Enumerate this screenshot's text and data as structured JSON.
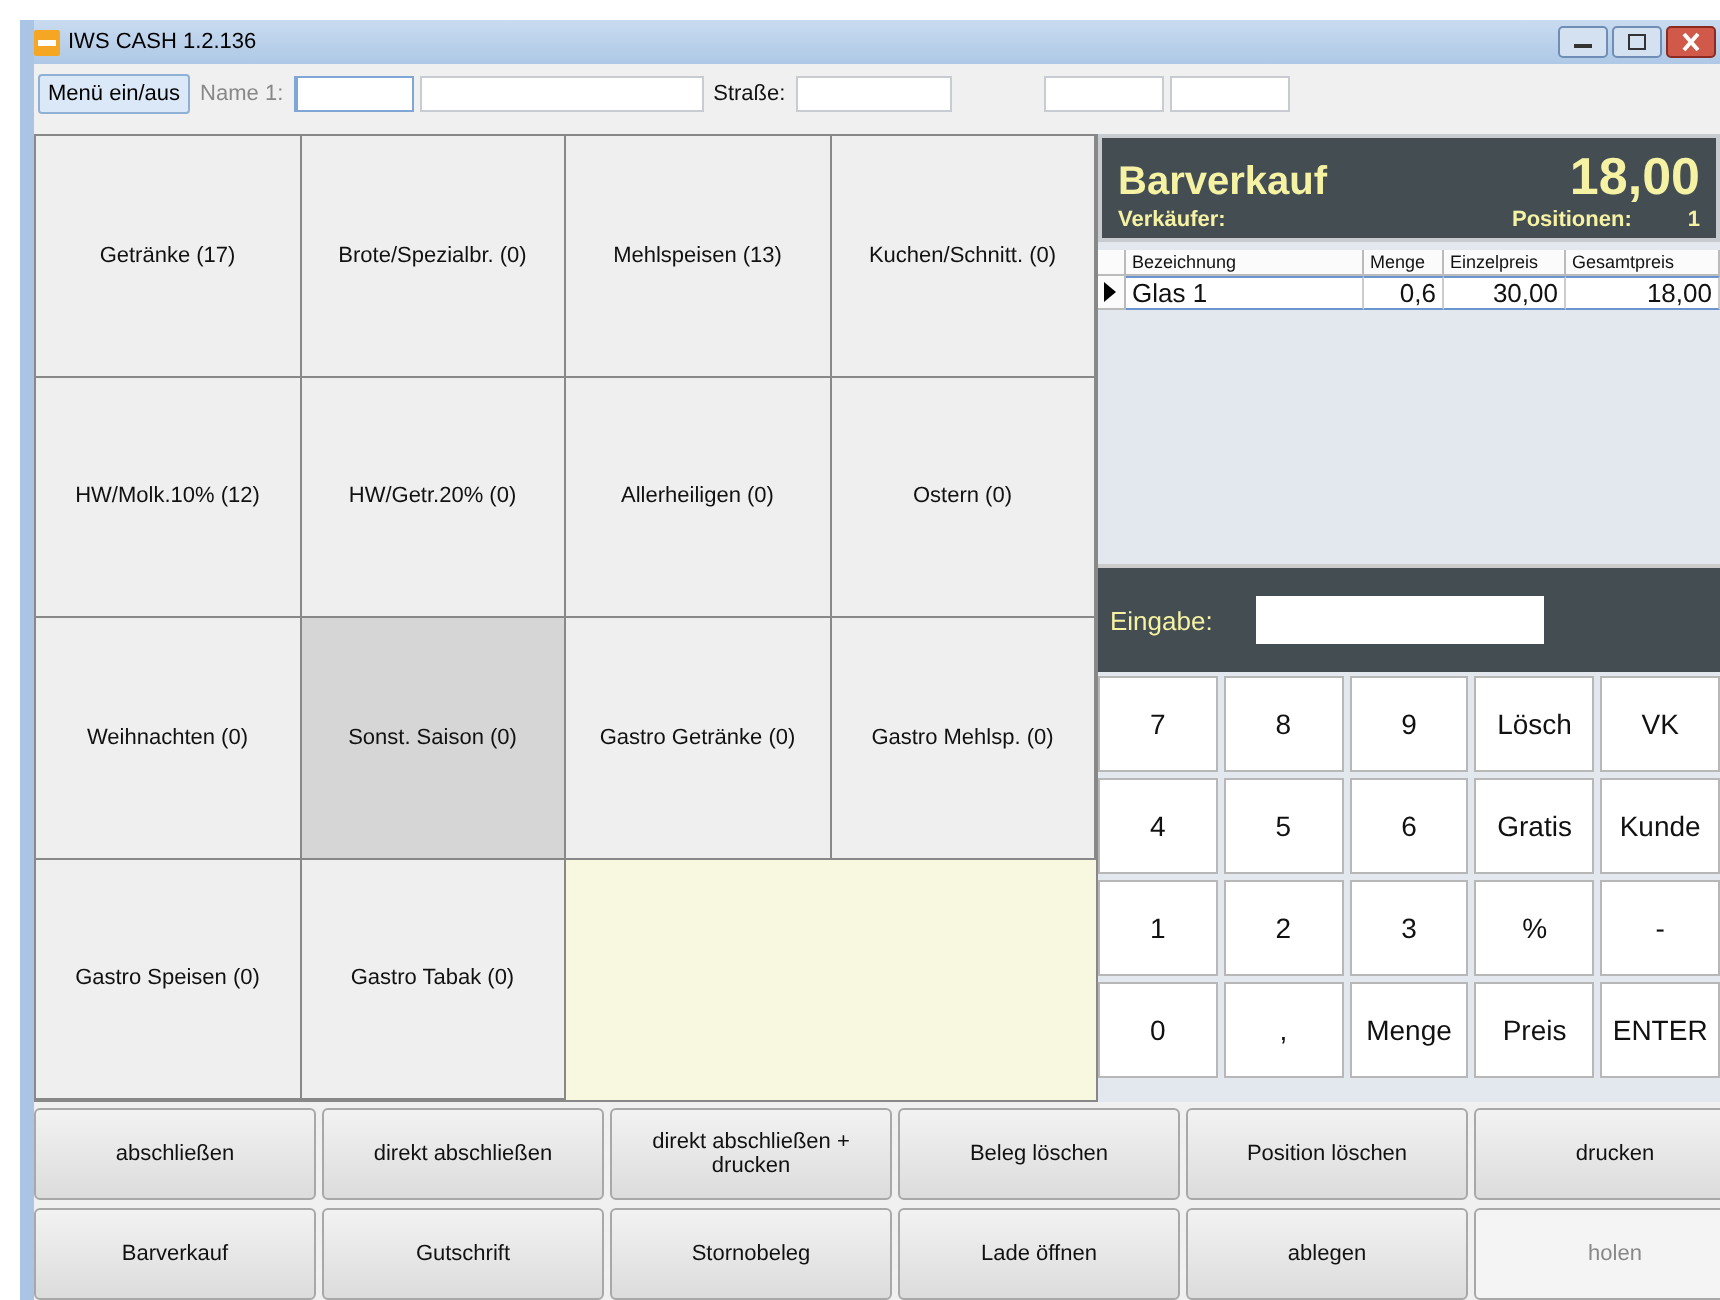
{
  "window": {
    "title": "IWS CASH 1.2.136"
  },
  "toolbar": [
    {
      "kind": "button",
      "label": "Menü ein/aus"
    },
    {
      "kind": "label",
      "label": "Name 1:",
      "dimmed": true
    },
    {
      "kind": "field",
      "focused": true
    },
    {
      "kind": "field",
      "focused": false
    },
    {
      "kind": "label",
      "label": "Straße:",
      "dimmed": false
    },
    {
      "kind": "field",
      "focused": false
    },
    {
      "kind": "gap"
    },
    {
      "kind": "field",
      "focused": false
    },
    {
      "kind": "field",
      "focused": false
    }
  ],
  "categories": [
    {
      "label": "Getränke (17)",
      "selected": false
    },
    {
      "label": "Brote/Spezialbr. (0)",
      "selected": false
    },
    {
      "label": "Mehlspeisen (13)",
      "selected": false
    },
    {
      "label": "Kuchen/Schnitt. (0)",
      "selected": false
    },
    {
      "label": "HW/Molk.10% (12)",
      "selected": false
    },
    {
      "label": "HW/Getr.20% (0)",
      "selected": false
    },
    {
      "label": "Allerheiligen (0)",
      "selected": false
    },
    {
      "label": "Ostern (0)",
      "selected": false
    },
    {
      "label": "Weihnachten (0)",
      "selected": false
    },
    {
      "label": "Sonst. Saison (0)",
      "selected": true
    },
    {
      "label": "Gastro Getränke (0)",
      "selected": false
    },
    {
      "label": "Gastro Mehlsp. (0)",
      "selected": false
    },
    {
      "label": "Gastro Speisen (0)",
      "selected": false
    },
    {
      "label": "Gastro Tabak (0)",
      "selected": false
    }
  ],
  "receipt": {
    "title": "Barverkauf",
    "total": "18,00",
    "seller_label": "Verkäufer:",
    "positions_label": "Positionen:",
    "positions_count": "1",
    "columns": [
      "Bezeichnung",
      "Menge",
      "Einzelpreis",
      "Gesamtpreis"
    ],
    "rows": [
      {
        "current": true,
        "cells": [
          "Glas 1",
          "0,6",
          "30,00",
          "18,00"
        ]
      }
    ]
  },
  "input": {
    "label": "Eingabe:"
  },
  "keypad": [
    "7",
    "8",
    "9",
    "Lösch",
    "VK",
    "4",
    "5",
    "6",
    "Gratis",
    "Kunde",
    "1",
    "2",
    "3",
    "%",
    "-",
    "0",
    ",",
    "Menge",
    "Preis",
    "ENTER"
  ],
  "actions": [
    [
      {
        "label": "abschließen",
        "disabled": false
      },
      {
        "label": "direkt abschließen",
        "disabled": false
      },
      {
        "label": "direkt abschließen + drucken",
        "disabled": false
      },
      {
        "label": "Beleg löschen",
        "disabled": false
      },
      {
        "label": "Position löschen",
        "disabled": false
      },
      {
        "label": "drucken",
        "disabled": false
      }
    ],
    [
      {
        "label": "Barverkauf",
        "disabled": false
      },
      {
        "label": "Gutschrift",
        "disabled": false
      },
      {
        "label": "Stornobeleg",
        "disabled": false
      },
      {
        "label": "Lade öffnen",
        "disabled": false
      },
      {
        "label": "ablegen",
        "disabled": false
      },
      {
        "label": "holen",
        "disabled": true
      }
    ]
  ]
}
